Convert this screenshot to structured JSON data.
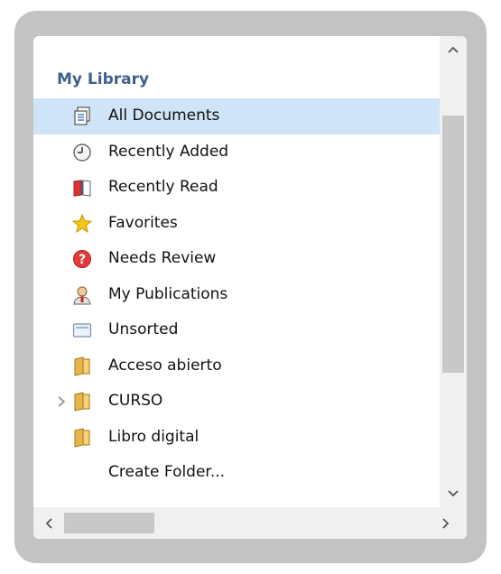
{
  "library": {
    "title": "My Library",
    "items": [
      {
        "label": "All Documents",
        "icon": "all-documents-icon",
        "selected": true
      },
      {
        "label": "Recently Added",
        "icon": "clock-icon"
      },
      {
        "label": "Recently Read",
        "icon": "open-book-icon"
      },
      {
        "label": "Favorites",
        "icon": "star-icon"
      },
      {
        "label": "Needs Review",
        "icon": "question-mark-icon"
      },
      {
        "label": "My Publications",
        "icon": "person-icon"
      },
      {
        "label": "Unsorted",
        "icon": "envelope-icon"
      },
      {
        "label": "Acceso abierto",
        "icon": "folder-icon"
      },
      {
        "label": "CURSO",
        "icon": "folder-icon",
        "expandable": true
      },
      {
        "label": "Libro digital",
        "icon": "folder-icon"
      },
      {
        "label": "Create Folder...",
        "icon": null
      }
    ]
  },
  "colors": {
    "frame": "#c3c3c3",
    "selection": "#cfe4f7",
    "heading": "#3f5f8c"
  }
}
